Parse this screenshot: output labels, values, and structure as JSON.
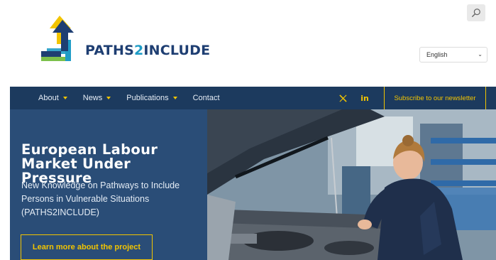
{
  "brand": {
    "name_part1": "PATHS",
    "name_part2": "2",
    "name_part3": "INCLUDE",
    "colors": {
      "navy": "#1e3e72",
      "cyan": "#1f9cc6",
      "green": "#7cc04b",
      "yellow": "#f2c400"
    }
  },
  "header": {
    "search_icon": "search-icon",
    "language": {
      "selected": "English",
      "icon": "chevron-down-icon"
    }
  },
  "nav": {
    "items": [
      {
        "label": "About",
        "has_dropdown": true
      },
      {
        "label": "News",
        "has_dropdown": true
      },
      {
        "label": "Publications",
        "has_dropdown": true
      },
      {
        "label": "Contact",
        "has_dropdown": false
      }
    ],
    "social": [
      {
        "name": "x-twitter-icon",
        "glyph": "X"
      },
      {
        "name": "linkedin-icon",
        "glyph": "in"
      }
    ],
    "subscribe_label": "Subscribe to our newsletter",
    "background": "#1c3a5e"
  },
  "hero": {
    "title": "European Labour Market Under Pressure",
    "subtitle": "New Knowledge on Pathways to Include Persons in Vulnerable Situations (PATHS2INCLUDE)",
    "cta_label": "Learn more about the project",
    "image": "photo of a female mechanic working under the open hood of a car in a workshop",
    "panel_color": "#2a4d77"
  }
}
